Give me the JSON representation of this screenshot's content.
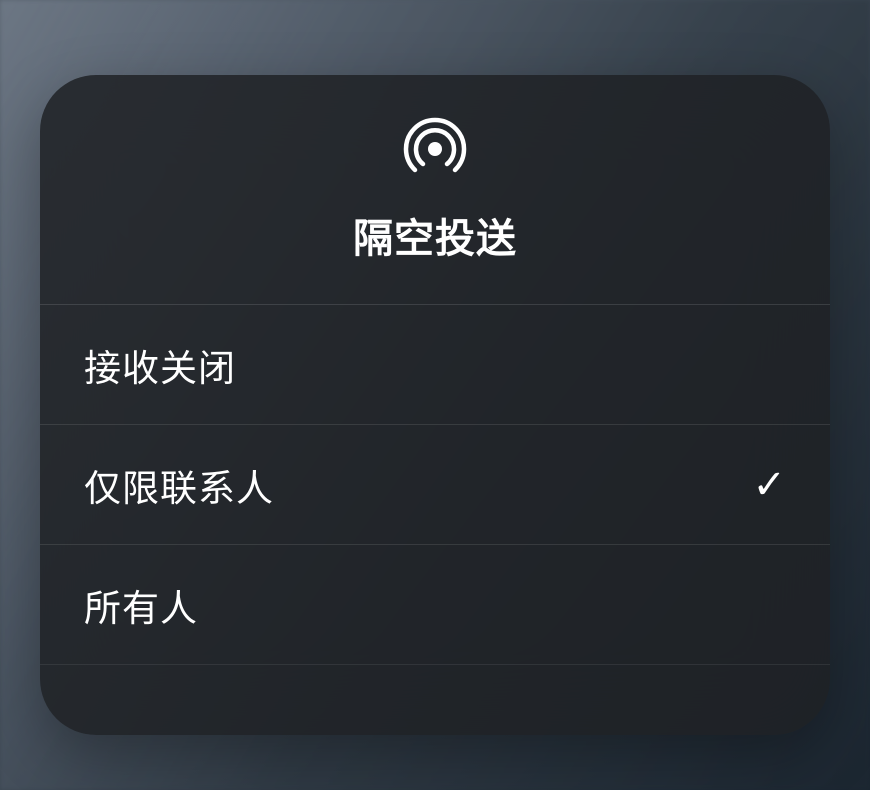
{
  "panel": {
    "title": "隔空投送",
    "icon_name": "airdrop-icon"
  },
  "options": [
    {
      "label": "接收关闭",
      "selected": false
    },
    {
      "label": "仅限联系人",
      "selected": true
    },
    {
      "label": "所有人",
      "selected": false
    }
  ]
}
